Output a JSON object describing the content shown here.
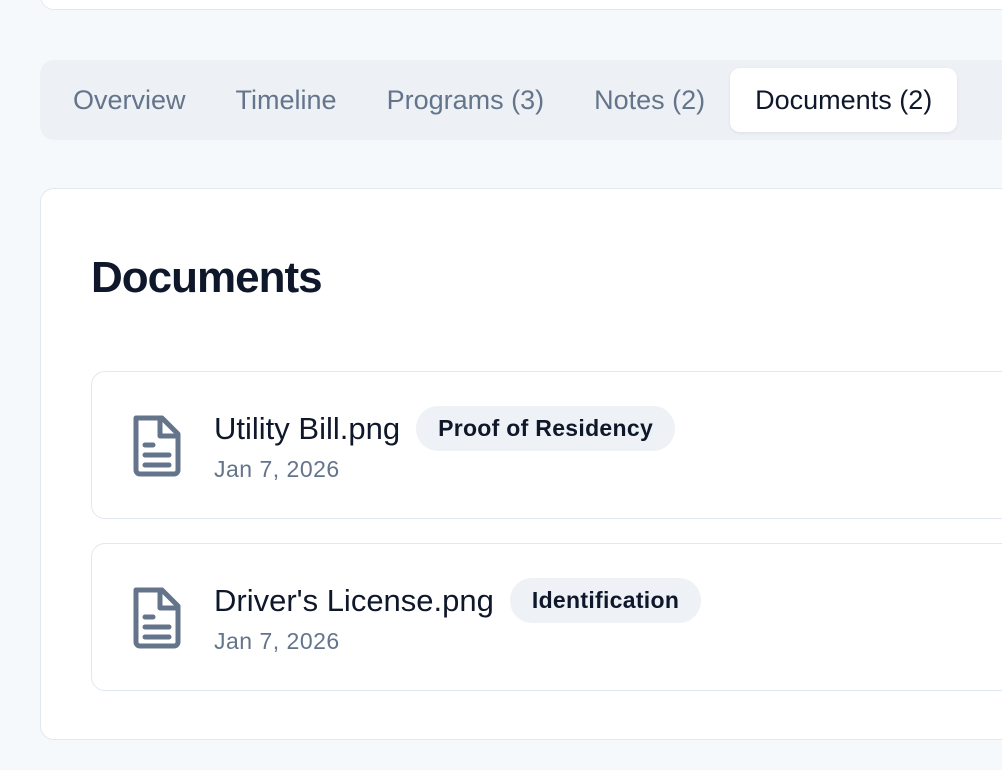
{
  "tabs": [
    {
      "label": "Overview"
    },
    {
      "label": "Timeline"
    },
    {
      "label": "Programs (3)"
    },
    {
      "label": "Notes (2)"
    },
    {
      "label": "Documents (2)"
    }
  ],
  "documents": {
    "title": "Documents",
    "items": [
      {
        "name": "Utility Bill.png",
        "tag": "Proof of Residency",
        "date": "Jan 7, 2026",
        "icon": "file-text-icon"
      },
      {
        "name": "Driver's License.png",
        "tag": "Identification",
        "date": "Jan 7, 2026",
        "icon": "file-text-icon"
      }
    ]
  }
}
